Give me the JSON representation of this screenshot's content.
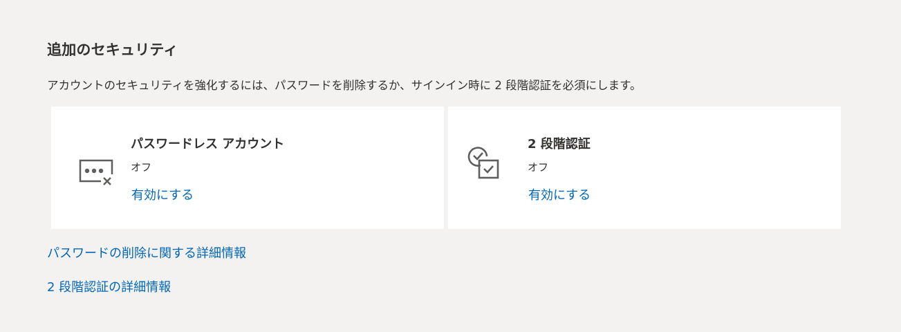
{
  "section": {
    "title": "追加のセキュリティ",
    "description": "アカウントのセキュリティを強化するには、パスワードを削除するか、サインイン時に 2 段階認証を必須にします。"
  },
  "cards": [
    {
      "icon": "passwordless-icon",
      "title": "パスワードレス アカウント",
      "status": "オフ",
      "action": "有効にする"
    },
    {
      "icon": "two-step-verification-icon",
      "title": "2 段階認証",
      "status": "オフ",
      "action": "有効にする"
    }
  ],
  "links": {
    "remove_password_info": "パスワードの削除に関する詳細情報",
    "two_step_info": "2 段階認証の詳細情報"
  },
  "colors": {
    "background": "#f3f2f1",
    "card": "#ffffff",
    "link": "#0067b8",
    "text": "#323130",
    "icon": "#605e5c"
  }
}
